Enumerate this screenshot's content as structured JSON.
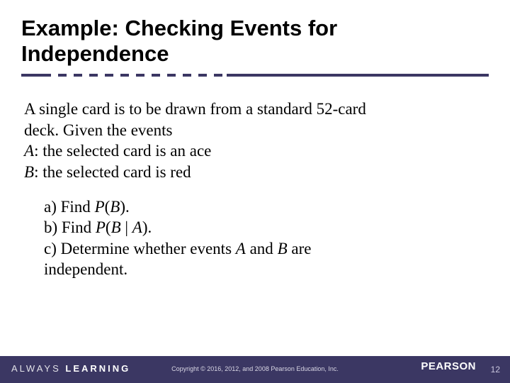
{
  "title": "Example: Checking Events for Independence",
  "body": {
    "intro_l1": "A single card is to be drawn from a standard 52-card",
    "intro_l2": "deck. Given the events",
    "eventA_label": "A",
    "eventA_text": ": the selected card is an ace",
    "eventB_label": "B",
    "eventB_text": ": the selected card is red",
    "qa_label": "a)  Find ",
    "qa_expr_p": "P",
    "qa_expr_open": "(",
    "qa_expr_arg": "B",
    "qa_expr_close": ").",
    "qb_label": "b)  Find ",
    "qb_expr_p": "P",
    "qb_expr_open": "(",
    "qb_expr_arg1": "B",
    "qb_expr_mid": " | ",
    "qb_expr_arg2": "A",
    "qb_expr_close": ").",
    "qc_label": "c)  Determine whether events ",
    "qc_a": "A",
    "qc_and": " and ",
    "qc_b": "B",
    "qc_tail": " are",
    "qc_l2": "independent."
  },
  "footer": {
    "always_light": "ALWAYS ",
    "always_bold": "LEARNING",
    "copyright": "Copyright © 2016, 2012, and 2008 Pearson Education, Inc.",
    "brand": "PEARSON",
    "page": "12"
  }
}
